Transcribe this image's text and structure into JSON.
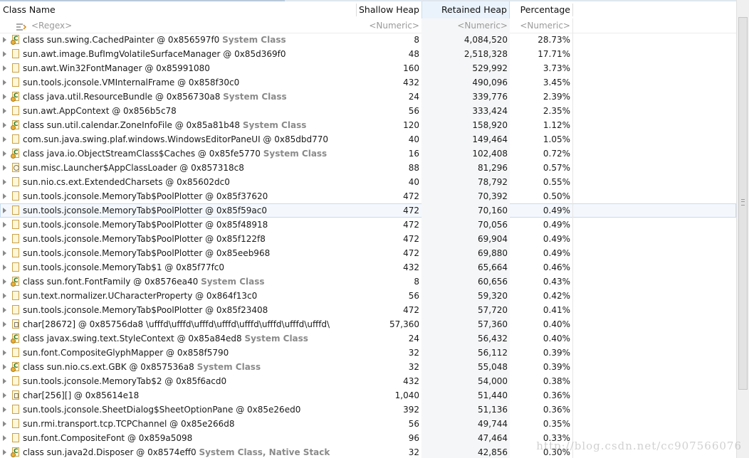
{
  "columns": {
    "name": "Class Name",
    "shallow": "Shallow Heap",
    "retained": "Retained Heap",
    "percentage": "Percentage"
  },
  "filters": {
    "name": "<Regex>",
    "shallow": "<Numeric>",
    "retained": "<Numeric>",
    "percentage": "<Numeric>"
  },
  "rows": [
    {
      "icon": "class-icon",
      "name": "class sun.swing.CachedPainter @ 0x856597f0",
      "tag": "System Class",
      "shallow": "8",
      "retained": "4,084,520",
      "pct": "28.73%"
    },
    {
      "icon": "object-icon",
      "name": "sun.awt.image.BufImgVolatileSurfaceManager @ 0x85d369f0",
      "tag": "",
      "shallow": "48",
      "retained": "2,518,328",
      "pct": "17.71%"
    },
    {
      "icon": "object-icon",
      "name": "sun.awt.Win32FontManager @ 0x85991080",
      "tag": "",
      "shallow": "160",
      "retained": "529,992",
      "pct": "3.73%"
    },
    {
      "icon": "object-icon",
      "name": "sun.tools.jconsole.VMInternalFrame @ 0x858f30c0",
      "tag": "",
      "shallow": "432",
      "retained": "490,096",
      "pct": "3.45%"
    },
    {
      "icon": "class-icon",
      "name": "class java.util.ResourceBundle @ 0x856730a8",
      "tag": "System Class",
      "shallow": "24",
      "retained": "339,776",
      "pct": "2.39%"
    },
    {
      "icon": "object-icon",
      "name": "sun.awt.AppContext @ 0x856b5c78",
      "tag": "",
      "shallow": "56",
      "retained": "333,424",
      "pct": "2.35%"
    },
    {
      "icon": "class-icon",
      "name": "class sun.util.calendar.ZoneInfoFile @ 0x85a81b48",
      "tag": "System Class",
      "shallow": "120",
      "retained": "158,920",
      "pct": "1.12%"
    },
    {
      "icon": "object-icon",
      "name": "com.sun.java.swing.plaf.windows.WindowsEditorPaneUI @ 0x85dbd770",
      "tag": "",
      "shallow": "40",
      "retained": "149,464",
      "pct": "1.05%"
    },
    {
      "icon": "class-icon",
      "name": "class java.io.ObjectStreamClass$Caches @ 0x85fe5770",
      "tag": "System Class",
      "shallow": "16",
      "retained": "102,408",
      "pct": "0.72%"
    },
    {
      "icon": "loader-icon",
      "name": "sun.misc.Launcher$AppClassLoader @ 0x857318c8",
      "tag": "",
      "shallow": "88",
      "retained": "81,296",
      "pct": "0.57%"
    },
    {
      "icon": "object-icon",
      "name": "sun.nio.cs.ext.ExtendedCharsets @ 0x85602dc0",
      "tag": "",
      "shallow": "40",
      "retained": "78,792",
      "pct": "0.55%"
    },
    {
      "icon": "object-icon",
      "name": "sun.tools.jconsole.MemoryTab$PoolPlotter @ 0x85f37620",
      "tag": "",
      "shallow": "472",
      "retained": "70,392",
      "pct": "0.50%"
    },
    {
      "icon": "object-icon",
      "name": "sun.tools.jconsole.MemoryTab$PoolPlotter @ 0x85f59ac0",
      "tag": "",
      "shallow": "472",
      "retained": "70,160",
      "pct": "0.49%",
      "selected": true
    },
    {
      "icon": "object-icon",
      "name": "sun.tools.jconsole.MemoryTab$PoolPlotter @ 0x85f48918",
      "tag": "",
      "shallow": "472",
      "retained": "70,056",
      "pct": "0.49%"
    },
    {
      "icon": "object-icon",
      "name": "sun.tools.jconsole.MemoryTab$PoolPlotter @ 0x85f122f8",
      "tag": "",
      "shallow": "472",
      "retained": "69,904",
      "pct": "0.49%"
    },
    {
      "icon": "object-icon",
      "name": "sun.tools.jconsole.MemoryTab$PoolPlotter @ 0x85eeb968",
      "tag": "",
      "shallow": "472",
      "retained": "69,880",
      "pct": "0.49%"
    },
    {
      "icon": "object-icon",
      "name": "sun.tools.jconsole.MemoryTab$1 @ 0x85f77fc0",
      "tag": "",
      "shallow": "432",
      "retained": "65,664",
      "pct": "0.46%"
    },
    {
      "icon": "class-icon",
      "name": "class sun.font.FontFamily @ 0x8576ea40",
      "tag": "System Class",
      "shallow": "8",
      "retained": "60,656",
      "pct": "0.43%"
    },
    {
      "icon": "object-icon",
      "name": "sun.text.normalizer.UCharacterProperty @ 0x864f13c0",
      "tag": "",
      "shallow": "56",
      "retained": "59,320",
      "pct": "0.42%"
    },
    {
      "icon": "object-icon",
      "name": "sun.tools.jconsole.MemoryTab$PoolPlotter @ 0x85f23408",
      "tag": "",
      "shallow": "472",
      "retained": "57,720",
      "pct": "0.41%"
    },
    {
      "icon": "array-icon",
      "name": "char[28672] @ 0x85756da8  \\ufffd\\ufffd\\ufffd\\ufffd\\ufffd\\ufffd\\ufffd\\ufffd\\",
      "tag": "",
      "shallow": "57,360",
      "retained": "57,360",
      "pct": "0.40%"
    },
    {
      "icon": "class-icon",
      "name": "class javax.swing.text.StyleContext @ 0x85a84ed8",
      "tag": "System Class",
      "shallow": "24",
      "retained": "56,432",
      "pct": "0.40%"
    },
    {
      "icon": "object-icon",
      "name": "sun.font.CompositeGlyphMapper @ 0x858f5790",
      "tag": "",
      "shallow": "32",
      "retained": "56,112",
      "pct": "0.39%"
    },
    {
      "icon": "class-icon",
      "name": "class sun.nio.cs.ext.GBK @ 0x857536a8",
      "tag": "System Class",
      "shallow": "32",
      "retained": "55,048",
      "pct": "0.39%"
    },
    {
      "icon": "object-icon",
      "name": "sun.tools.jconsole.MemoryTab$2 @ 0x85f6acd0",
      "tag": "",
      "shallow": "432",
      "retained": "54,000",
      "pct": "0.38%"
    },
    {
      "icon": "array-icon",
      "name": "char[256][] @ 0x85614e18",
      "tag": "",
      "shallow": "1,040",
      "retained": "51,440",
      "pct": "0.36%"
    },
    {
      "icon": "object-icon",
      "name": "sun.tools.jconsole.SheetDialog$SheetOptionPane @ 0x85e26ed0",
      "tag": "",
      "shallow": "392",
      "retained": "51,136",
      "pct": "0.36%"
    },
    {
      "icon": "object-icon",
      "name": "sun.rmi.transport.tcp.TCPChannel @ 0x85e266d8",
      "tag": "",
      "shallow": "56",
      "retained": "49,744",
      "pct": "0.35%"
    },
    {
      "icon": "object-icon",
      "name": "sun.font.CompositeFont @ 0x859a5098",
      "tag": "",
      "shallow": "96",
      "retained": "47,464",
      "pct": "0.33%"
    },
    {
      "icon": "class-icon",
      "name": "class sun.java2d.Disposer @ 0x8574eff0",
      "tag": "System Class, Native Stack",
      "shallow": "32",
      "retained": "42,856",
      "pct": "0.30%"
    }
  ],
  "watermark": "http://blog.csdn.net/cc907566076"
}
